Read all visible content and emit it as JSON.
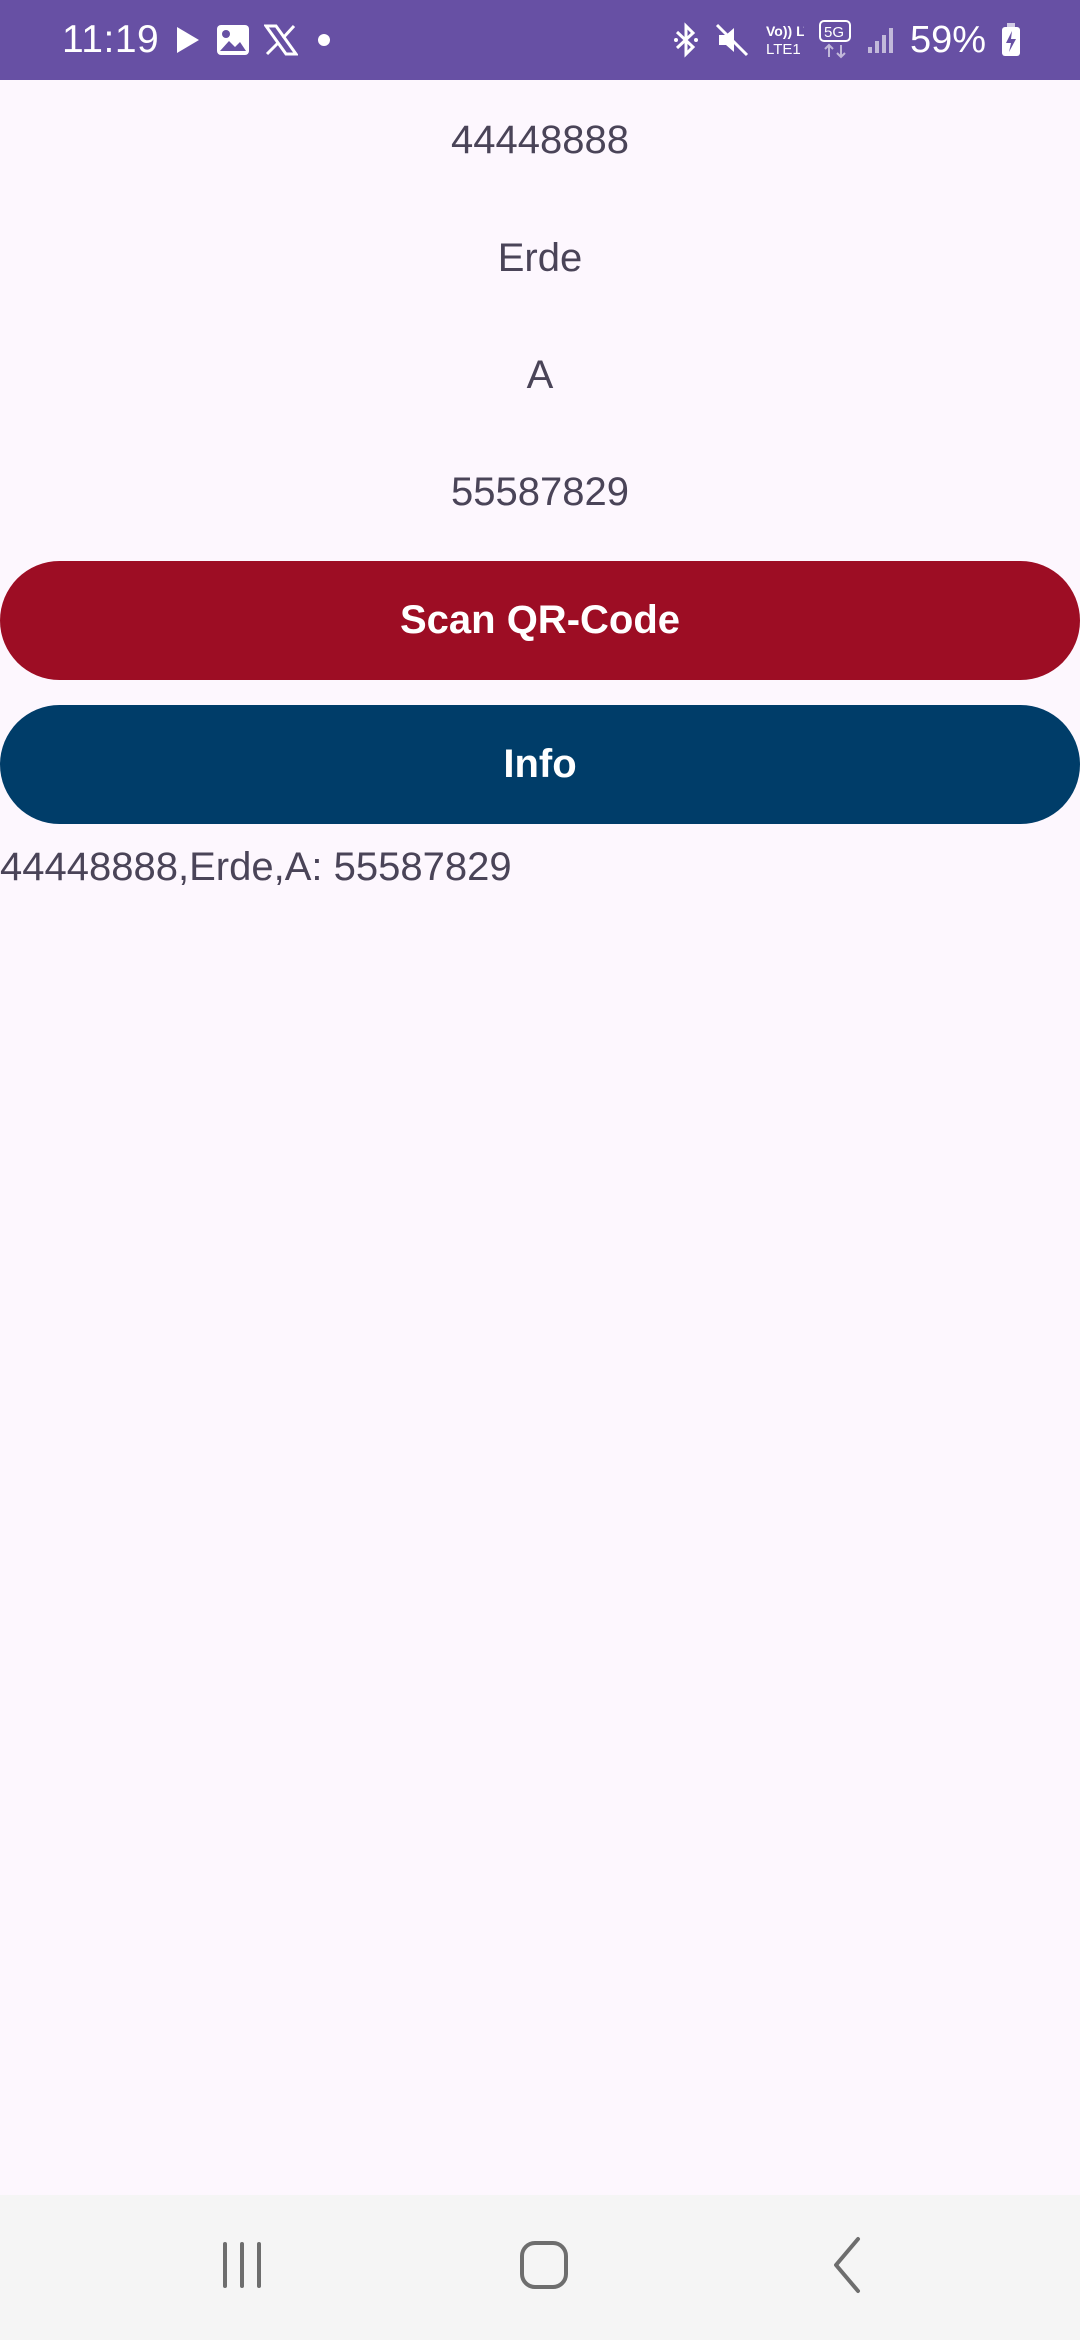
{
  "status_bar": {
    "time": "11:19",
    "battery_percent": "59%",
    "left_icons": [
      "play-store-icon",
      "gallery-icon",
      "x-icon",
      "dot-icon"
    ],
    "right_icons": [
      "bluetooth-icon",
      "mute-icon",
      "volte-icon",
      "5g-icon",
      "signal-icon",
      "battery-icon"
    ],
    "network_labels": {
      "volte": "Vo)) LTE1",
      "fiveg": "5G"
    },
    "color": "#6750a4"
  },
  "main": {
    "fields": [
      "44448888",
      "Erde",
      "A",
      "55587829"
    ],
    "scan_button_label": "Scan QR-Code",
    "scan_button_color": "#9d0d24",
    "info_button_label": "Info",
    "info_button_color": "#003d69",
    "result_text": "44448888,Erde,A: 55587829"
  },
  "nav_bar": {
    "buttons": [
      "recent-apps",
      "home",
      "back"
    ]
  }
}
